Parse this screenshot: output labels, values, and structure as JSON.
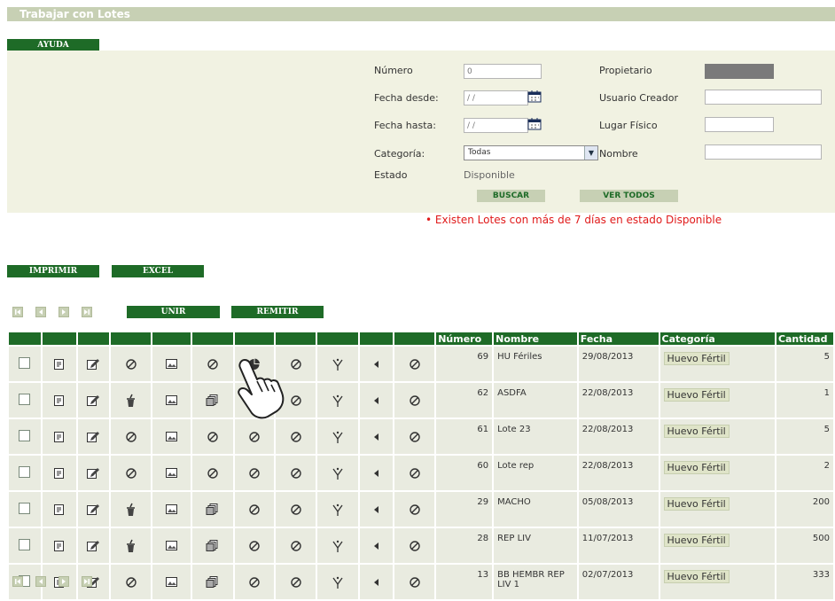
{
  "title": "Trabajar con Lotes",
  "buttons": {
    "ayuda": "AYUDA",
    "buscar": "BUSCAR",
    "ver_todos": "VER TODOS",
    "imprimir": "IMPRIMIR",
    "excel": "EXCEL",
    "unir": "UNIR",
    "remitir": "REMITIR"
  },
  "search": {
    "numero_label": "Número",
    "numero_value": "0",
    "fecha_desde_label": "Fecha desde:",
    "fecha_desde_value": " / /",
    "fecha_hasta_label": "Fecha hasta:",
    "fecha_hasta_value": " / /",
    "categoria_label": "Categoría:",
    "categoria_value": "Todas",
    "estado_label": "Estado",
    "estado_value": "Disponible",
    "propietario_label": "Propietario",
    "usuario_creador_label": "Usuario Creador",
    "lugar_fisico_label": "Lugar Físico",
    "nombre_label": "Nombre"
  },
  "warning": "•  Existen Lotes con más de 7 días en estado Disponible",
  "table": {
    "headers": [
      "Número",
      "Nombre",
      "Fecha",
      "Categoría",
      "Cantidad"
    ],
    "rows": [
      {
        "numero": "69",
        "nombre": "HU Fériles",
        "fecha": "29/08/2013",
        "categoria": "Huevo Fértil",
        "cantidad": "5",
        "icons": [
          "ban",
          "img",
          "ban",
          "pie",
          "ban"
        ]
      },
      {
        "numero": "62",
        "nombre": "ASDFA",
        "fecha": "22/08/2013",
        "categoria": "Huevo Fértil",
        "cantidad": "1",
        "icons": [
          "trash",
          "img",
          "stack",
          "ban",
          "ban"
        ]
      },
      {
        "numero": "61",
        "nombre": "Lote 23",
        "fecha": "22/08/2013",
        "categoria": "Huevo Fértil",
        "cantidad": "5",
        "icons": [
          "ban",
          "img",
          "ban",
          "ban",
          "ban"
        ]
      },
      {
        "numero": "60",
        "nombre": "Lote rep",
        "fecha": "22/08/2013",
        "categoria": "Huevo Fértil",
        "cantidad": "2",
        "icons": [
          "ban",
          "img",
          "ban",
          "ban",
          "ban"
        ]
      },
      {
        "numero": "29",
        "nombre": "MACHO",
        "fecha": "05/08/2013",
        "categoria": "Huevo Fértil",
        "cantidad": "200",
        "icons": [
          "trash",
          "img",
          "stack",
          "ban",
          "ban"
        ]
      },
      {
        "numero": "28",
        "nombre": "REP LIV",
        "fecha": "11/07/2013",
        "categoria": "Huevo Fértil",
        "cantidad": "500",
        "icons": [
          "trash",
          "img",
          "stack",
          "ban",
          "ban"
        ]
      },
      {
        "numero": "13",
        "nombre": "BB HEMBR REP LIV 1",
        "fecha": "02/07/2013",
        "categoria": "Huevo Fértil",
        "cantidad": "333",
        "icons": [
          "ban",
          "img",
          "stack",
          "ban",
          "ban"
        ]
      }
    ]
  },
  "colors": {
    "header_green": "#1e6b27",
    "panel_bg": "#f1f2e2",
    "warning_red": "#e01a1a"
  }
}
